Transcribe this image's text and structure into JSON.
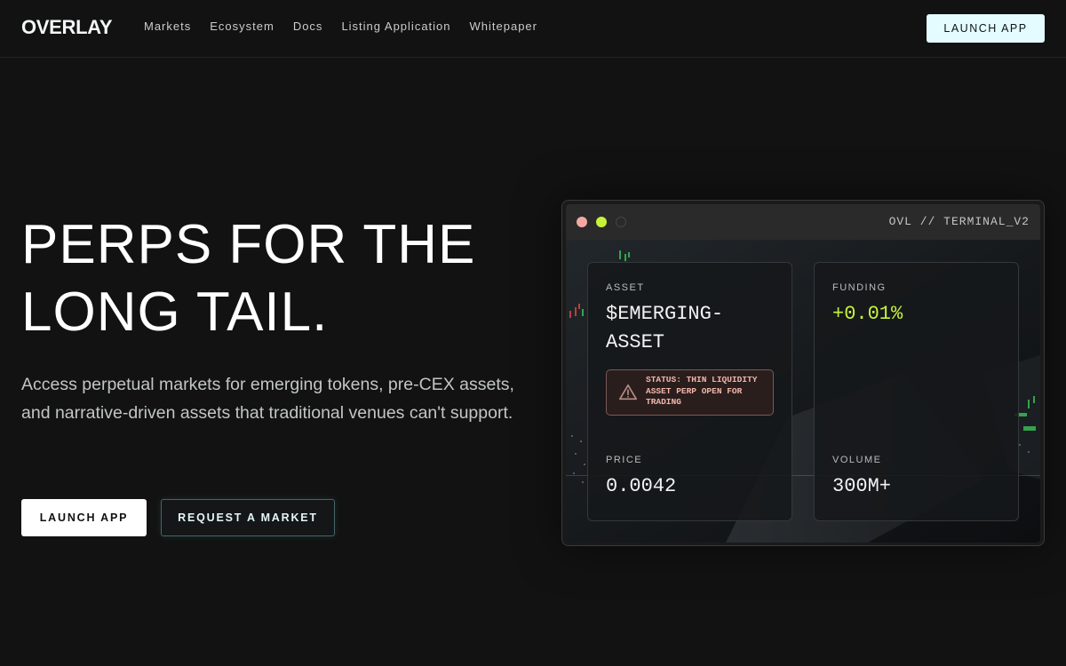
{
  "brand": {
    "logo": "OVERLAY"
  },
  "nav": {
    "items": [
      {
        "label": "Markets"
      },
      {
        "label": "Ecosystem"
      },
      {
        "label": "Docs"
      },
      {
        "label": "Listing Application"
      },
      {
        "label": "Whitepaper"
      }
    ],
    "cta_label": "LAUNCH APP"
  },
  "hero": {
    "title_line1": "PERPS FOR THE",
    "title_line2": "LONG TAIL.",
    "subtitle": "Access perpetual markets for emerging tokens, pre-CEX assets, and narrative-driven assets that traditional venues can't support.",
    "primary_label": "LAUNCH APP",
    "secondary_label": "REQUEST A MARKET"
  },
  "terminal": {
    "title": "OVL // TERMINAL_V2",
    "asset_label": "ASSET",
    "asset_value": "$EMERGING-ASSET",
    "status_text": "STATUS: THIN LIQUIDITY ASSET PERP OPEN FOR TRADING",
    "funding_label": "FUNDING",
    "funding_value": "+0.01%",
    "price_label": "PRICE",
    "price_value": "0.0042",
    "volume_label": "VOLUME",
    "volume_value": "300M+"
  },
  "colors": {
    "background": "#121212",
    "accent_green": "#c7f23a",
    "cta_bg": "#e4fcff",
    "status_text": "#f4b7ac",
    "dot_red": "#f4a8a2"
  },
  "icons": [
    "warning-icon"
  ]
}
